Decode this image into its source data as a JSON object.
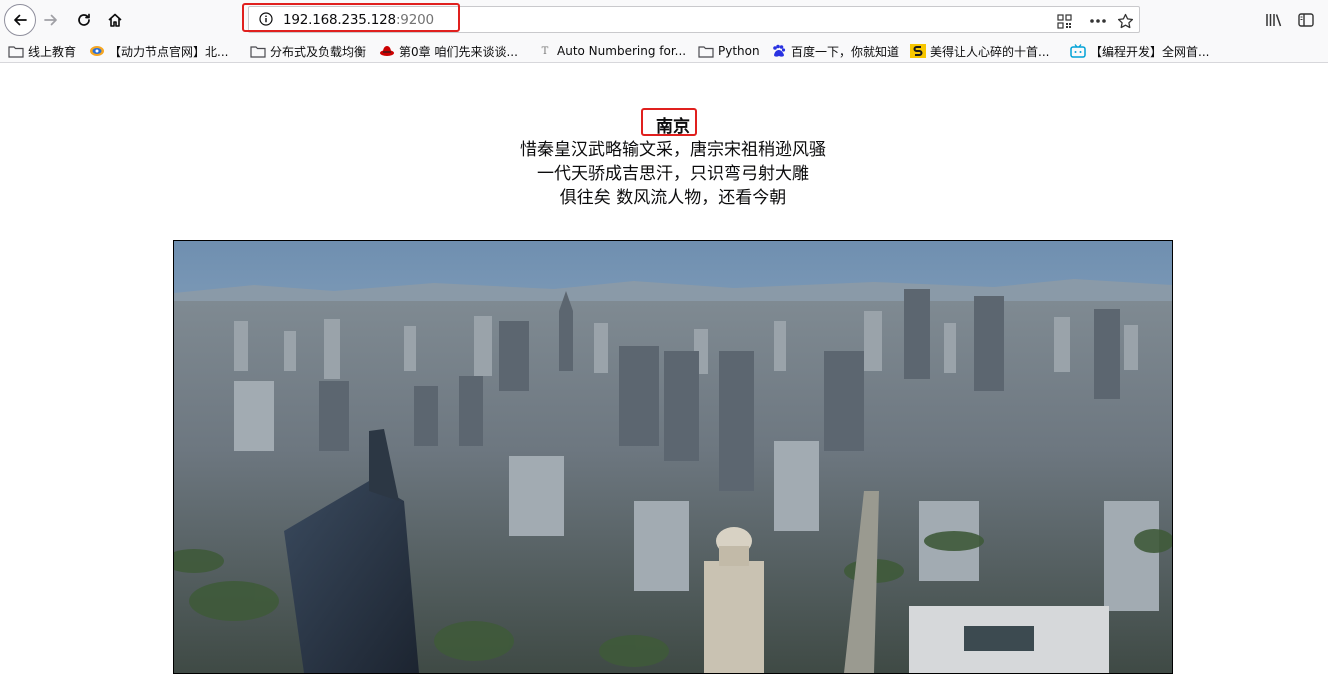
{
  "browser": {
    "url_host": "192.168.235.128",
    "url_port": ":9200",
    "buttons": {
      "back": "back-icon",
      "forward": "forward-icon",
      "reload": "reload-icon",
      "home": "home-icon",
      "qr": "qr-code-icon",
      "more": "more-icon",
      "bookmark_star": "star-icon",
      "library": "library-icon",
      "sidebar": "sidebar-icon"
    }
  },
  "bookmarks": [
    {
      "label": "线上教育",
      "icon": "folder-icon"
    },
    {
      "label": "【动力节点官网】北...",
      "icon": "site-icon"
    },
    {
      "label": "分布式及负载均衡",
      "icon": "folder-icon"
    },
    {
      "label": "第0章 咱们先来谈谈...",
      "icon": "redhat-icon"
    },
    {
      "label": "Auto Numbering for...",
      "icon": "t-icon"
    },
    {
      "label": "Python",
      "icon": "folder-icon"
    },
    {
      "label": "百度一下，你就知道",
      "icon": "baidu-icon"
    },
    {
      "label": "美得让人心碎的十首...",
      "icon": "s-icon"
    },
    {
      "label": "【编程开发】全网首...",
      "icon": "bilibili-icon"
    }
  ],
  "page": {
    "title": "南京",
    "poem": [
      "惜秦皇汉武略输文采，唐宗宋祖稍逊风骚",
      "一代天骄成吉思汗，只识弯弓射大雕",
      "俱往矣 数风流人物，还看今朝"
    ],
    "image": "city-skyline-photo"
  },
  "colors": {
    "highlight": "#e0201e",
    "toolbar_bg": "#f9f9fa"
  }
}
